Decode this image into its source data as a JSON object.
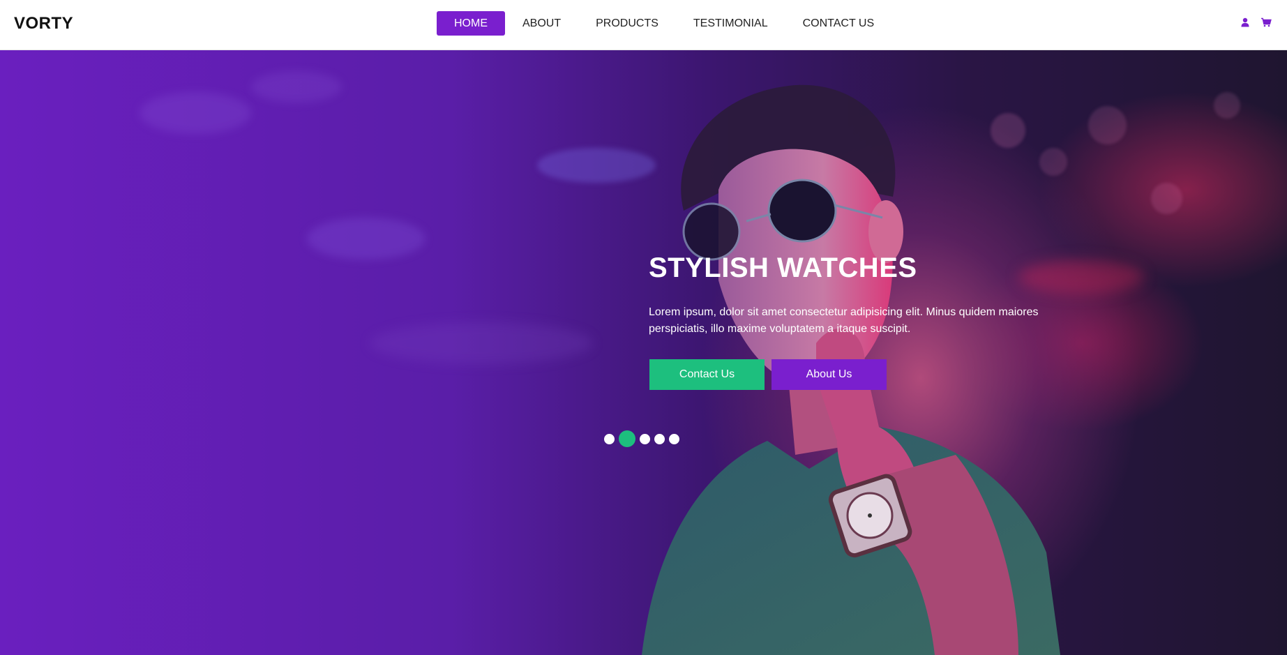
{
  "brand": "VORTY",
  "nav": {
    "items": [
      {
        "label": "HOME",
        "active": true
      },
      {
        "label": "ABOUT",
        "active": false
      },
      {
        "label": "PRODUCTS",
        "active": false
      },
      {
        "label": "TESTIMONIAL",
        "active": false
      },
      {
        "label": "CONTACT US",
        "active": false
      }
    ],
    "icons": [
      "user-icon",
      "cart-icon"
    ]
  },
  "hero": {
    "title": "STYLISH WATCHES",
    "text": "Lorem ipsum, dolor sit amet consectetur adipisicing elit. Minus quidem maiores perspiciatis, illo maxime voluptatem a itaque suscipit.",
    "buttons": {
      "contact": "Contact Us",
      "about": "About Us"
    },
    "slider": {
      "count": 5,
      "active_index": 1
    }
  },
  "colors": {
    "accent_purple": "#7a1fce",
    "accent_green": "#1dbf7e",
    "text_dark": "#111111"
  }
}
